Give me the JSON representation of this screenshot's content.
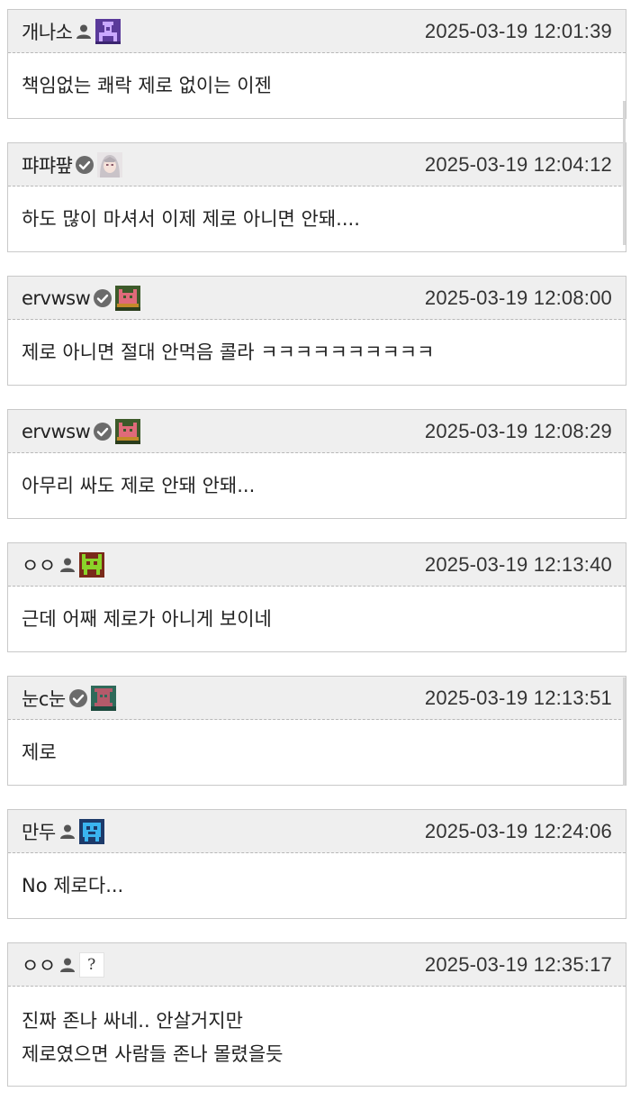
{
  "comments": [
    {
      "nickname": "개나소",
      "badge": "person-icon",
      "avatar": "pixel-avatar-purple-icon",
      "time": "2025-03-19 12:01:39",
      "lines": [
        "책임없는 쾌락 제로 없이는 이젠"
      ]
    },
    {
      "nickname": "퍄퍄퍞",
      "badge": "verified-check-icon",
      "avatar": "anime-avatar-icon",
      "time": "2025-03-19 12:04:12",
      "lines": [
        "하도 많이 마셔서 이제 제로 아니면 안돼...."
      ]
    },
    {
      "nickname": "ervwsw",
      "badge": "verified-check-icon",
      "avatar": "pixel-avatar-pink-icon",
      "time": "2025-03-19 12:08:00",
      "lines": [
        "제로 아니면 절대 안먹음 콜라 ㅋㅋㅋㅋㅋㅋㅋㅋㅋㅋ"
      ]
    },
    {
      "nickname": "ervwsw",
      "badge": "verified-check-icon",
      "avatar": "pixel-avatar-pink-icon",
      "time": "2025-03-19 12:08:29",
      "lines": [
        "아무리 싸도 제로 안돼 안돼..."
      ]
    },
    {
      "nickname": "ㅇㅇ",
      "badge": "person-icon",
      "avatar": "pixel-avatar-green-icon",
      "time": "2025-03-19 12:13:40",
      "lines": [
        "근데 어째 제로가 아니게 보이네"
      ]
    },
    {
      "nickname": "눈c눈",
      "badge": "verified-check-icon",
      "avatar": "pixel-avatar-teal-icon",
      "time": "2025-03-19 12:13:51",
      "lines": [
        "제로"
      ]
    },
    {
      "nickname": "만두",
      "badge": "person-icon",
      "avatar": "pixel-avatar-blue-icon",
      "time": "2025-03-19 12:24:06",
      "lines": [
        "No 제로다..."
      ]
    },
    {
      "nickname": "ㅇㅇ",
      "badge": "person-icon",
      "avatar": "question-mark-avatar-icon",
      "avatar_text": "?",
      "time": "2025-03-19 12:35:17",
      "lines": [
        "진짜 존나 싸네.. 안살거지만",
        "제로였으면 사람들 존나 몰렸을듯"
      ]
    }
  ]
}
